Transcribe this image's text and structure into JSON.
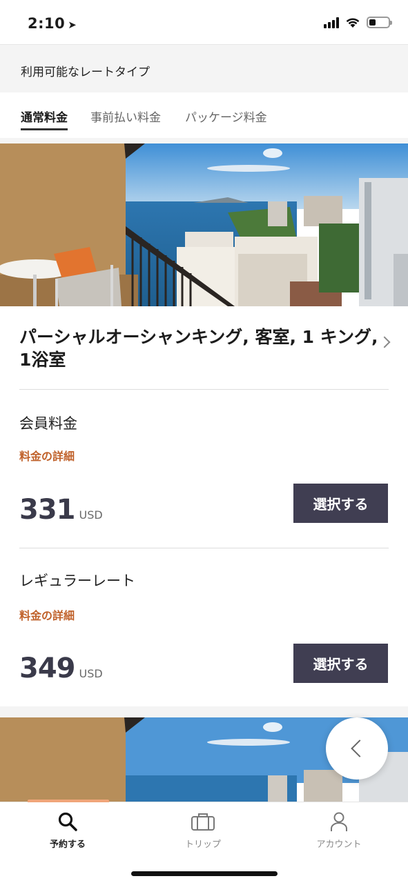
{
  "status_bar": {
    "time": "2:10",
    "location_glyph": "➤"
  },
  "header": {
    "title": "利用可能なレートタイプ"
  },
  "tabs": [
    {
      "label": "通常料金",
      "active": true
    },
    {
      "label": "事前払い料金",
      "active": false
    },
    {
      "label": "パッケージ料金",
      "active": false
    }
  ],
  "room": {
    "title": "パーシャルオーシャンキング, 客室, 1 キング, 1浴室",
    "rates": [
      {
        "name": "会員料金",
        "details_link": "料金の詳細",
        "price": "331",
        "currency": "USD",
        "button": "選択する"
      },
      {
        "name": "レギュラーレート",
        "details_link": "料金の詳細",
        "price": "349",
        "currency": "USD",
        "button": "選択する"
      }
    ]
  },
  "bottom_nav": [
    {
      "label": "予約する",
      "icon": "search-icon",
      "active": true
    },
    {
      "label": "トリップ",
      "icon": "briefcase-icon",
      "active": false
    },
    {
      "label": "アカウント",
      "icon": "person-icon",
      "active": false
    }
  ],
  "colors": {
    "accent": "#c0622b",
    "button": "#403e52",
    "nav_accent": "#f0a57a"
  }
}
